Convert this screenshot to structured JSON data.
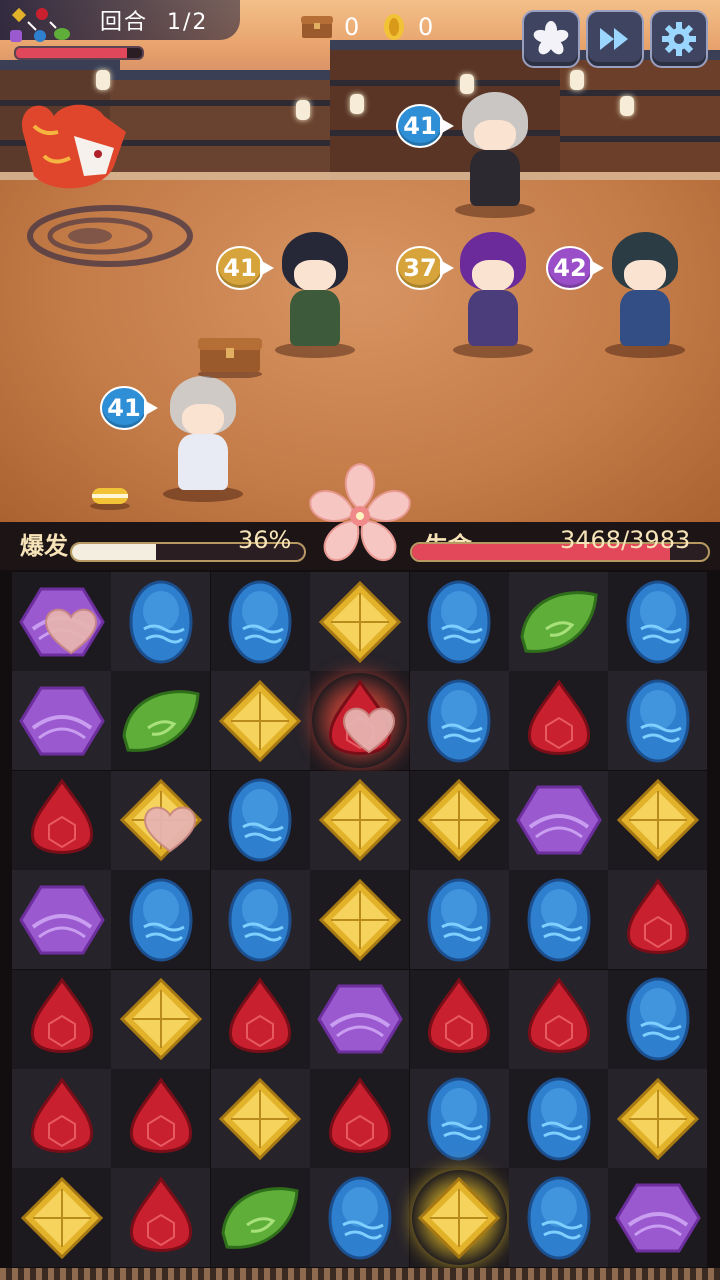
{
  "hud": {
    "turn_label": "回合",
    "turn_value": "1/2",
    "chest_count": "0",
    "coin_count": "0",
    "enemy_hp_fraction": 0.88,
    "buttons": [
      {
        "name": "sakura-skill-button",
        "icon": "sakura-icon"
      },
      {
        "name": "fast-forward-button",
        "icon": "fast-forward-icon"
      },
      {
        "name": "settings-button",
        "icon": "gear-icon"
      }
    ]
  },
  "units": [
    {
      "id": "ally-1",
      "level": "41",
      "badge_color": "blue"
    },
    {
      "id": "ally-2",
      "level": "41",
      "badge_color": "gold"
    },
    {
      "id": "ally-3",
      "level": "37",
      "badge_color": "gold"
    },
    {
      "id": "ally-4",
      "level": "42",
      "badge_color": "purple"
    },
    {
      "id": "ally-5",
      "level": "41",
      "badge_color": "blue"
    }
  ],
  "status": {
    "burst_label": "爆发",
    "burst_value": "36%",
    "burst_fraction": 0.36,
    "life_label": "生命",
    "life_value": "3468/3983",
    "life_fraction": 0.8707
  },
  "colors": {
    "purple": "#9b59d0",
    "blue": "#2f7fcf",
    "gold": "#e2b32a",
    "green": "#5fae3a",
    "red": "#c8202e",
    "burst_fill": "#f4eee0",
    "life_fill": "#e2475a"
  },
  "board": {
    "rows": [
      [
        "purple-heart",
        "blue",
        "blue",
        "gold",
        "blue",
        "green",
        "blue"
      ],
      [
        "purple",
        "green",
        "gold",
        "red-heart-selected",
        "blue",
        "red",
        "blue"
      ],
      [
        "red",
        "gold-heart",
        "blue",
        "gold",
        "gold",
        "purple",
        "gold"
      ],
      [
        "purple",
        "blue",
        "blue",
        "gold",
        "blue",
        "blue",
        "red"
      ],
      [
        "red",
        "gold",
        "red",
        "purple",
        "red",
        "red",
        "blue"
      ],
      [
        "red",
        "red",
        "gold",
        "red",
        "blue",
        "blue",
        "gold"
      ],
      [
        "gold",
        "red",
        "green",
        "blue",
        "gold-selected",
        "blue",
        "purple"
      ]
    ]
  }
}
